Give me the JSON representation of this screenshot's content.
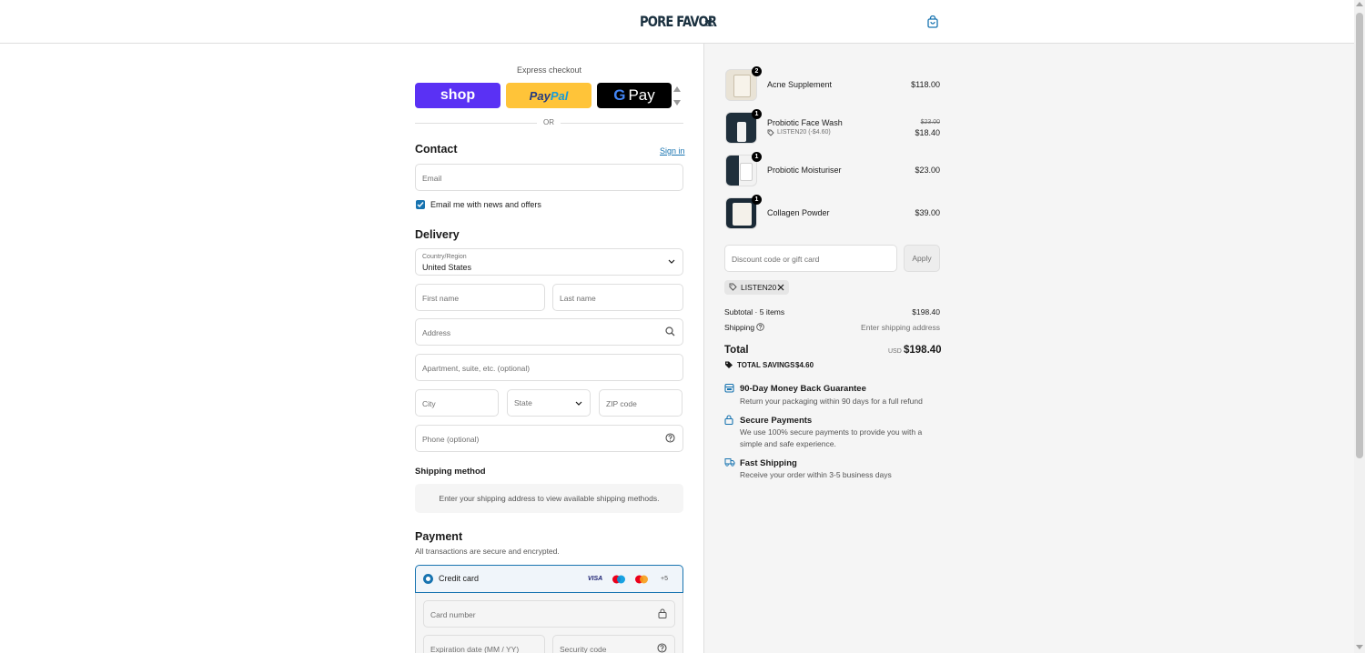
{
  "header": {
    "logo_text": "PORE FAVOR"
  },
  "express": {
    "title": "Express checkout",
    "shop_label": "shop",
    "paypal_label_1": "Pay",
    "paypal_label_2": "Pal",
    "gpay_g": "G",
    "gpay_label": "Pay",
    "or_label": "OR"
  },
  "contact": {
    "title": "Contact",
    "sign_in": "Sign in",
    "email_placeholder": "Email",
    "newsletter_label": "Email me with news and offers",
    "newsletter_checked": true
  },
  "delivery": {
    "title": "Delivery",
    "country_label": "Country/Region",
    "country_value": "United States",
    "first_name": "First name",
    "last_name": "Last name",
    "address": "Address",
    "apartment": "Apartment, suite, etc. (optional)",
    "city": "City",
    "state": "State",
    "zip": "ZIP code",
    "phone": "Phone (optional)"
  },
  "shipping_method": {
    "title": "Shipping method",
    "notice": "Enter your shipping address to view available shipping methods."
  },
  "payment": {
    "title": "Payment",
    "subtitle": "All transactions are secure and encrypted.",
    "method_label": "Credit card",
    "card_brands": [
      "VISA",
      "maestro",
      "mastercard"
    ],
    "more_brands": "+5",
    "card_number": "Card number",
    "expiration": "Expiration date (MM / YY)",
    "security_code": "Security code"
  },
  "summary": {
    "items": [
      {
        "name": "Acne Supplement",
        "qty": "2",
        "price": "$118.00",
        "original_price": "",
        "discount": ""
      },
      {
        "name": "Probiotic Face Wash",
        "qty": "1",
        "price": "$18.40",
        "original_price": "$23.00",
        "discount": "LISTEN20 (-$4.60)"
      },
      {
        "name": "Probiotic Moisturiser",
        "qty": "1",
        "price": "$23.00",
        "original_price": "",
        "discount": ""
      },
      {
        "name": "Collagen Powder",
        "qty": "1",
        "price": "$39.00",
        "original_price": "",
        "discount": ""
      }
    ],
    "discount_placeholder": "Discount code or gift card",
    "apply_label": "Apply",
    "applied_code": "LISTEN20",
    "subtotal_label": "Subtotal · 5 items",
    "subtotal_value": "$198.40",
    "shipping_label": "Shipping",
    "shipping_value": "Enter shipping address",
    "total_label": "Total",
    "currency": "USD",
    "total_value": "$198.40",
    "savings_label": "TOTAL SAVINGS",
    "savings_value": "$4.60"
  },
  "features": [
    {
      "icon": "calendar-icon",
      "title": "90-Day Money Back Guarantee",
      "desc": "Return your packaging within 90 days for a full refund"
    },
    {
      "icon": "lock-icon",
      "title": "Secure Payments",
      "desc": "We use 100% secure payments to provide you with a simple and safe experience."
    },
    {
      "icon": "truck-icon",
      "title": "Fast Shipping",
      "desc": "Receive your order within 3-5 business days"
    }
  ],
  "colors": {
    "accent": "#1773b0",
    "shop_purple": "#5a31f4",
    "paypal_yellow": "#ffc439",
    "logo_navy": "#1b3140"
  }
}
